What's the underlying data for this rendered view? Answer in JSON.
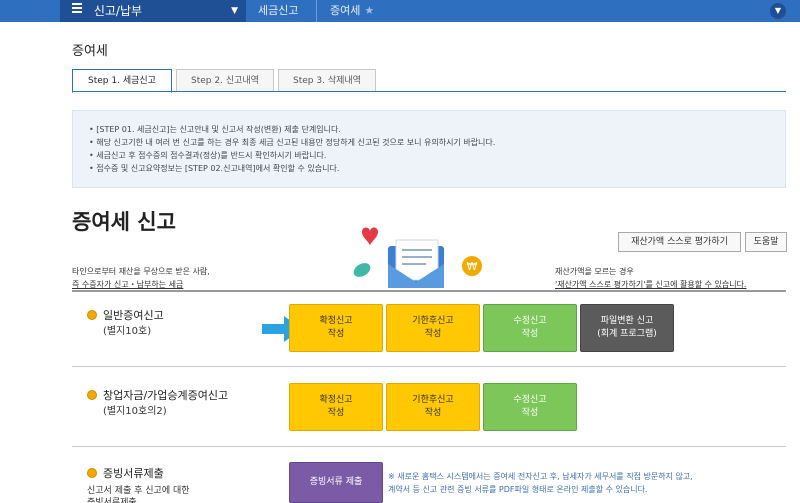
{
  "nav": {
    "menu_label": "신고/납부",
    "crumb1": "세금신고",
    "crumb2": "증여세"
  },
  "page_title": "증여세",
  "tabs": [
    {
      "label": "Step 1. 세금신고"
    },
    {
      "label": "Step 2. 신고내역"
    },
    {
      "label": "Step 3. 삭제내역"
    }
  ],
  "info": {
    "items": [
      "[STEP 01. 세금신고]는 신고안내 및 신고서 작성(변환) 제출 단계입니다.",
      "해당 신고기한 내 여러 번 신고를 하는 경우 최종 세금 신고된 내용만 정당하게 신고된 것으로 보니 유의하시기 바랍니다.",
      "세금신고 후 접수증의 접수결과(정상)를 반드시 확인하시기 바랍니다.",
      "접수증 및 신고요약정보는 [STEP 02.신고내역]에서 확인할 수 있습니다."
    ]
  },
  "main_title": "증여세 신고",
  "buttons": {
    "self_eval": "재산가액 스스로 평가하기",
    "help": "도움말"
  },
  "desc_left": {
    "line1": "타인으로부터 재산을 무상으로 받은 사람,",
    "line2": "즉 수증자가 신고・납부하는 세금"
  },
  "desc_right": {
    "line1": "재산가액을 모르는 경우",
    "line2": "'재산가액 스스로 평가하기'를 신고에 활용할 수 있습니다."
  },
  "sections": [
    {
      "title": "일반증여신고",
      "sub": "(별지10호)",
      "actions": [
        {
          "l1": "확정신고",
          "l2": "작성"
        },
        {
          "l1": "기한후신고",
          "l2": "작성"
        },
        {
          "l1": "수정신고",
          "l2": "작성"
        },
        {
          "l1": "파일변환 신고",
          "l2": "(회계 프로그램)"
        }
      ]
    },
    {
      "title": "창업자금/가업승계증여신고",
      "sub": "(별지10호의2)",
      "actions": [
        {
          "l1": "확정신고",
          "l2": "작성"
        },
        {
          "l1": "기한후신고",
          "l2": "작성"
        },
        {
          "l1": "수정신고",
          "l2": "작성"
        }
      ]
    },
    {
      "title": "증빙서류제출",
      "sub": "신고서 제출 후 신고에 대한",
      "sub2": "증빙서류제출",
      "action": "증빙서류 제출"
    }
  ],
  "note": {
    "line1": "※ 새로운 홈택스 시스템에서는 증여세 전자신고 후, 납세자가 세무서를 직접 방문하지 않고,",
    "line2": "계약서 등 신고 관련 증빙 서류를 PDF파일 형태로 온라인 제출할 수 있습니다."
  },
  "colors": {
    "nav_blue": "#2f6fbf",
    "yellow_btn": "#ffc800",
    "green_btn": "#7cc65a",
    "dark_btn": "#5b5b5b",
    "purple_btn": "#7b5aa6"
  }
}
